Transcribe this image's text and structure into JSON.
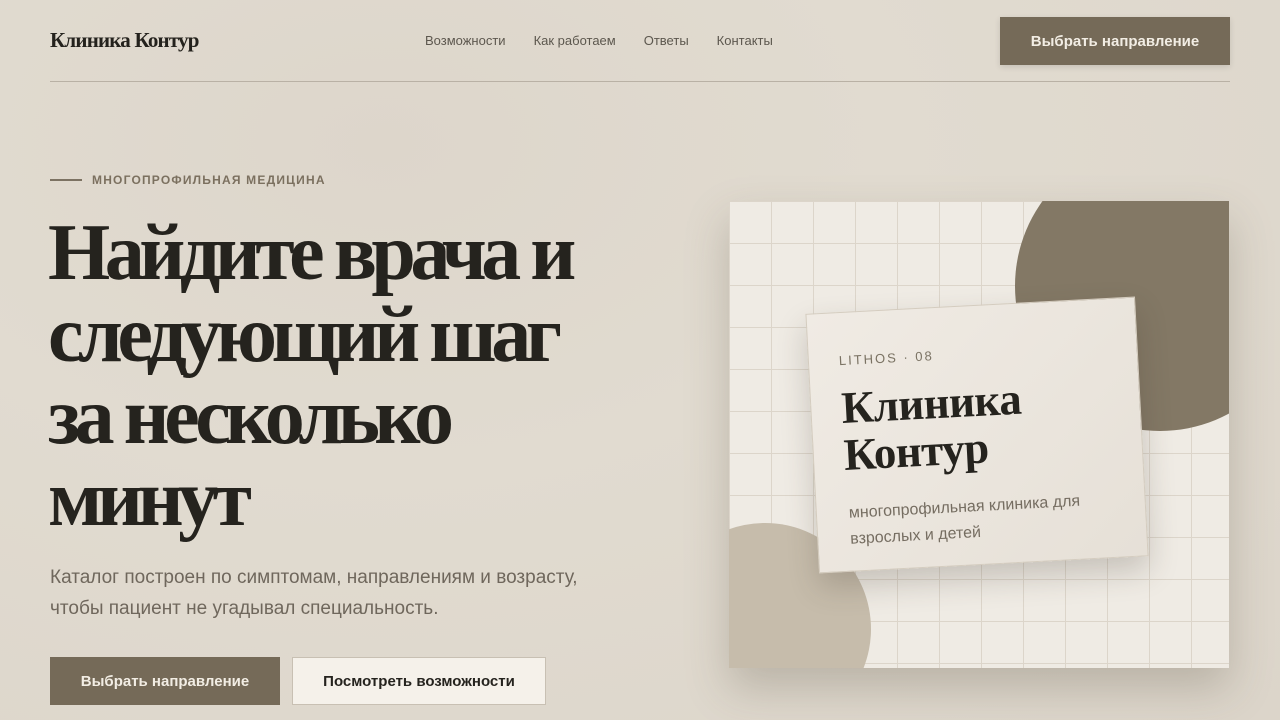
{
  "header": {
    "logo": "Клиника Контур",
    "nav": [
      "Возможности",
      "Как работаем",
      "Ответы",
      "Контакты"
    ],
    "cta": "Выбрать направление"
  },
  "hero": {
    "eyebrow": "МНОГОПРОФИЛЬНАЯ МЕДИЦИНА",
    "title_lines": [
      "Найдите врача и",
      "следующий шаг",
      "за несколько",
      "минут"
    ],
    "description_lines": [
      "Каталог построен по симптомам, направлениям и возрасту,",
      "чтобы пациент не угадывал специальность."
    ],
    "primary_button": "Выбрать направление",
    "secondary_button": "Посмотреть возможности"
  },
  "card": {
    "kicker": "LITHOS · 08",
    "title_lines": [
      "Клиника",
      "Контур"
    ],
    "subtitle": "многопрофильная клиника для взрослых и детей"
  },
  "colors": {
    "accent": "#756a58",
    "background": "#e1dbd0",
    "text": "#25231e"
  }
}
